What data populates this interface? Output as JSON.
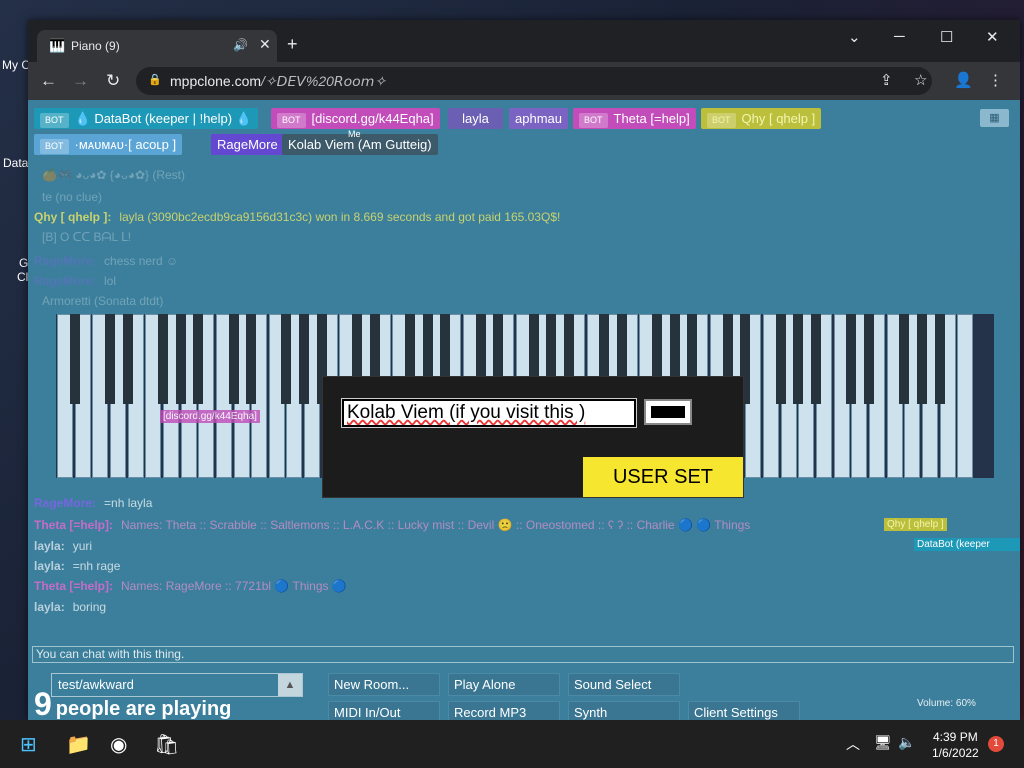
{
  "desktop": {
    "icons": [
      {
        "label": "My C"
      },
      {
        "label": "Data"
      },
      {
        "label": "G"
      },
      {
        "label": "Cl"
      }
    ]
  },
  "browser": {
    "tab": {
      "title": "Piano (9)"
    },
    "window_controls": {
      "minimize": "─",
      "maximize": "☐",
      "close": "✕"
    },
    "address": {
      "host": "mppclone.com",
      "path": "/✧𝘋𝘌𝘝%20𝘙𝘰𝘰𝘮✧"
    }
  },
  "app": {
    "users": [
      {
        "bot": true,
        "label": "BOT",
        "name": "💧 DataBot (keeper | !help) 💧",
        "color": "#1d98b7"
      },
      {
        "bot": true,
        "label": "BOT",
        "name": "[discord.gg/k44Eqha]",
        "color": "#c24cb9"
      },
      {
        "bot": false,
        "name": "layla",
        "color": "#6a5fb2"
      },
      {
        "bot": false,
        "name": "aphmau",
        "color": "#7a63c2"
      },
      {
        "bot": true,
        "label": "BOT",
        "name": "Theta [=help]",
        "color": "#c24cb9"
      },
      {
        "bot": true,
        "label": "BOT",
        "name": "Qhy [ qhelp ]",
        "color": "#bcbf3c"
      },
      {
        "bot": true,
        "label": "BOT",
        "name": "·ᴍᴀᴜᴍᴀᴜ·[ aᴄᴏʟp ]",
        "color": "#5aa5d6"
      },
      {
        "bot": false,
        "name": "RageMore",
        "color": "#6448d1"
      },
      {
        "bot": false,
        "name": "Kolab Viem (Am Gutteig)",
        "color": "#3d5a6a",
        "me": "Me"
      }
    ],
    "chat": [
      {
        "name": "",
        "text": "🍊🎮 ◕ᴗ◕✿ {◕ᴗ◕✿} (Rest)",
        "faded": true
      },
      {
        "name": "",
        "text": "te (no clue)",
        "faded": true
      },
      {
        "name": "Qhy [ qhelp ]:",
        "text": "layla (3090bc2ecdb9ca9156d31c3c) won in 8.669 seconds and got paid 165.03Q$!",
        "faded": false
      },
      {
        "name": "",
        "text": "[B] O ᑕᑕ BᗩL ᒪ!",
        "faded": true
      },
      {
        "name": "RageMore:",
        "text": "chess nerd ☺",
        "faded": true
      },
      {
        "name": "RageMore:",
        "text": "lol",
        "faded": true
      },
      {
        "name": "",
        "text": "Armoretti (Sonata dtdt)",
        "faded": true
      },
      {
        "name": "RageMore:",
        "text": "=nh layla",
        "faded": false
      },
      {
        "name": "Theta [=help]:",
        "text": "Names: Theta :: Scrabble :: Saltlemons :: L.A.C.K :: Lucky mist :: Devil 🙁 :: Oneostomed :: ʕ ʔ :: Charlie 🔵 🔵 Things",
        "faded": false
      },
      {
        "name": "layla:",
        "text": "yuri",
        "faded": false
      },
      {
        "name": "layla:",
        "text": "=nh rage",
        "faded": false
      },
      {
        "name": "Theta [=help]:",
        "text": "Names: RageMore :: 7721bl 🔵 Things 🔵",
        "faded": false
      },
      {
        "name": "layla:",
        "text": "boring",
        "faded": false
      }
    ],
    "cursor_labels": [
      "[discord.gg/k44Eqha]",
      "Qhy [ qhelp ]",
      "DataBot (keeper"
    ],
    "modal": {
      "name_value": "Kolab Viem (if you visit this )",
      "submit_label": "USER SET",
      "color": "#000000"
    },
    "chat_placeholder": "You can chat with this thing.",
    "room": {
      "value": "test/awkward",
      "arrow": "▲"
    },
    "players": {
      "count": "9",
      "text": "people are playing"
    },
    "buttons": {
      "new_room": "New Room...",
      "play_alone": "Play Alone",
      "sound_select": "Sound Select",
      "midi": "MIDI In/Out",
      "record": "Record MP3",
      "synth": "Synth",
      "client_settings": "Client Settings"
    },
    "volume": "Volume: 60%"
  },
  "taskbar": {
    "time": "4:39 PM",
    "date": "1/6/2022",
    "notifications": "1"
  }
}
